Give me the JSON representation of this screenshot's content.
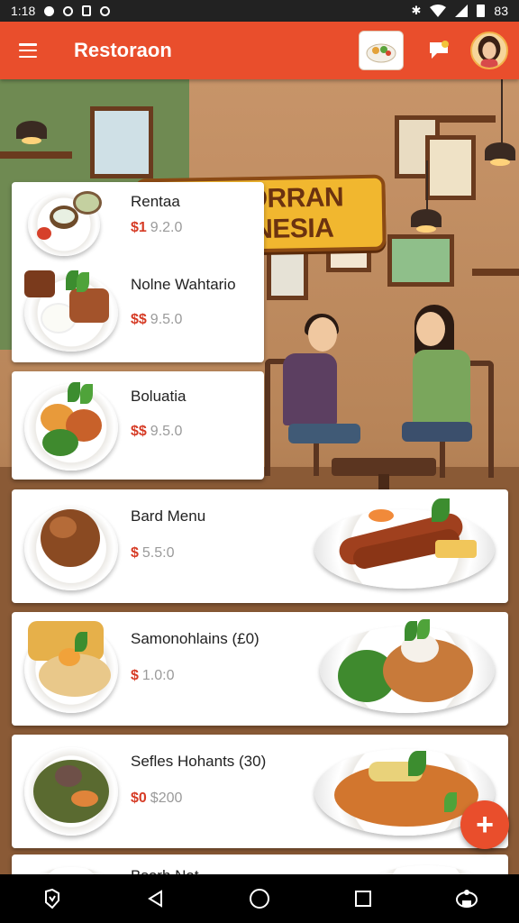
{
  "status_bar": {
    "time": "1:18",
    "battery": "83"
  },
  "app_bar": {
    "title": "Restoraon"
  },
  "banner": {
    "line1": "RESTORRAN",
    "line2": "INDONESIA"
  },
  "menu_items": [
    {
      "name": "Rentaa",
      "currency": "$1",
      "price": "9.2.0"
    },
    {
      "name": "Nolne Wahtario",
      "currency": "$$",
      "price": "9.5.0"
    },
    {
      "name": "Boluatia",
      "currency": "$$",
      "price": "9.5.0"
    },
    {
      "name": "Bard Menu",
      "currency": "$",
      "price": "5.5:0"
    },
    {
      "name": "Samonohlains (£0)",
      "currency": "$",
      "price": "1.0:0"
    },
    {
      "name": "Sefles Hohants (30)",
      "currency": "$0",
      "price": "$200"
    },
    {
      "name": "Bsorh Nat",
      "currency": "",
      "price": ""
    }
  ],
  "icons": {
    "menu": "hamburger-icon",
    "food": "food-bowl-icon",
    "chat": "chat-bubble-icon",
    "add": "plus-icon",
    "back": "back-triangle-icon",
    "home": "home-circle-icon",
    "recents": "recents-square-icon"
  },
  "colors": {
    "accent": "#e94e2c",
    "price": "#d63b25"
  }
}
